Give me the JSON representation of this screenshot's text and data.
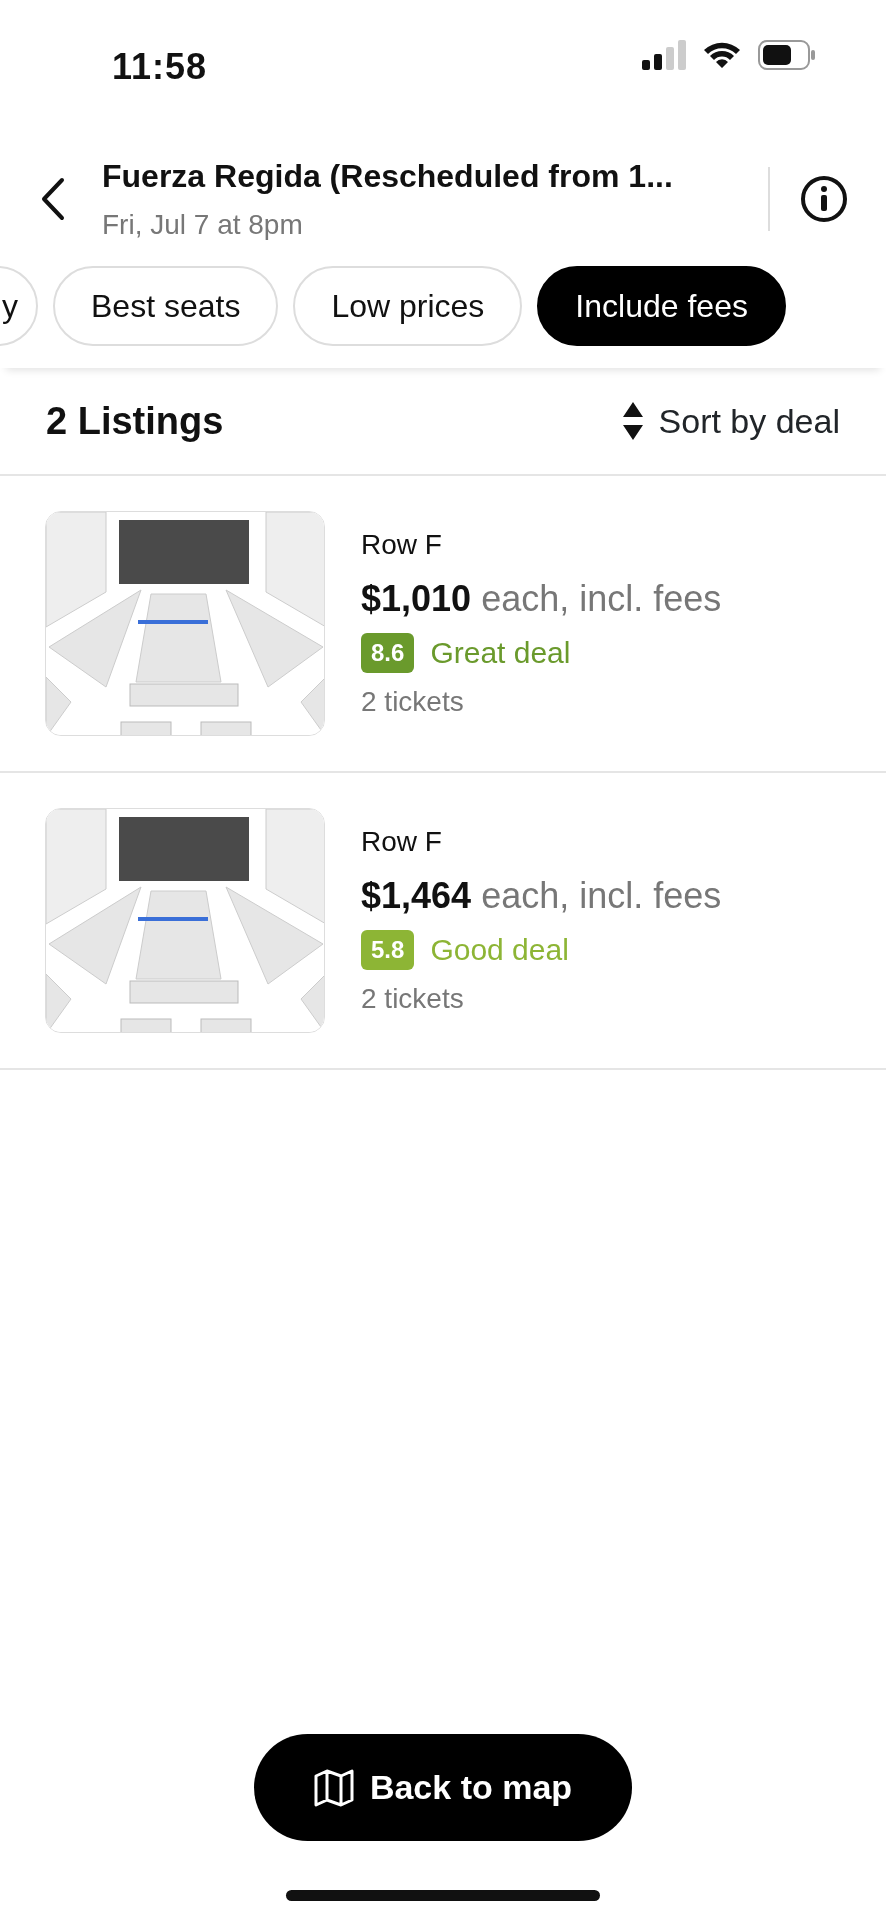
{
  "status_bar": {
    "time": "11:58"
  },
  "header": {
    "title": "Fuerza Regida (Rescheduled from 1...",
    "subtitle": "Fri, Jul 7 at 8pm"
  },
  "filters": [
    {
      "label": "y",
      "selected": false
    },
    {
      "label": "Best seats",
      "selected": false
    },
    {
      "label": "Low prices",
      "selected": false
    },
    {
      "label": "Include fees",
      "selected": true
    }
  ],
  "listings_header": {
    "count": "2 Listings",
    "sort": "Sort by deal"
  },
  "listings": [
    {
      "row": "Row F",
      "price": "$1,010",
      "price_note": "each, incl. fees",
      "score": "8.6",
      "deal": "Great deal",
      "color": "#6a9a2c",
      "tickets": "2 tickets"
    },
    {
      "row": "Row F",
      "price": "$1,464",
      "price_note": "each, incl. fees",
      "score": "5.8",
      "deal": "Good deal",
      "color": "#8db535",
      "tickets": "2 tickets"
    }
  ],
  "back_button": {
    "label": "Back to map"
  }
}
